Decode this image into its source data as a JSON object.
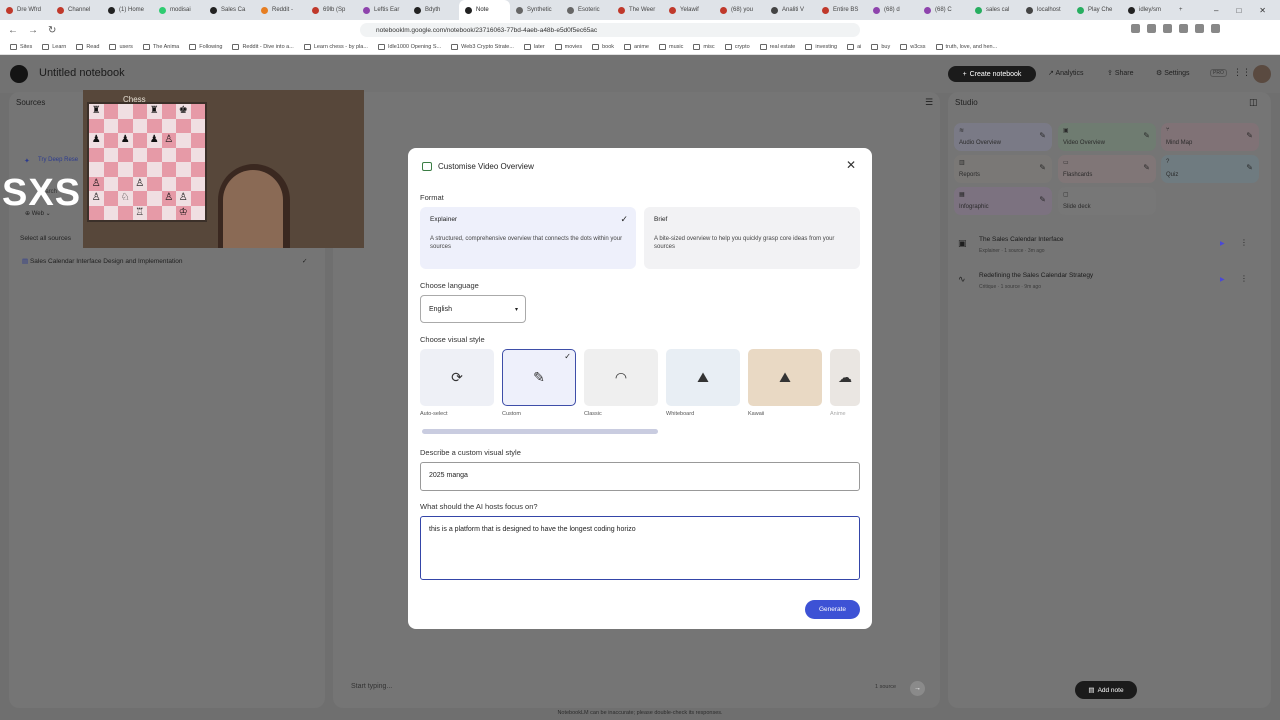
{
  "browser": {
    "tabs": [
      "Dre Wfrd",
      "Channel",
      "(1) Home",
      "modisai",
      "Sales Ca",
      "Reddit -",
      "69lb (Sp",
      "Leftis Ear",
      "Bdyth",
      "Note",
      "Synthetic",
      "Esoteric",
      "The Weer",
      "Yelawif",
      "(68) you",
      "Analiti V",
      "Entire BS",
      "(68) d",
      "(68) C",
      "sales cal",
      "localhost",
      "Play Che",
      "idley/sm"
    ],
    "url": "notebooklm.google.com/notebook/23716063-77bd-4aeb-a48b-e5d0f5ec65ac",
    "bookmarks": [
      "Sites",
      "Learn",
      "Read",
      "users",
      "The Anima",
      "Following",
      "Reddit - Dive into a...",
      "Learn chess - by pla...",
      "Idle1000 Opening S...",
      "Web3 Crypto Strate...",
      "later",
      "movies",
      "book",
      "anime",
      "music",
      "misc",
      "crypto",
      "real estate",
      "investing",
      "ai",
      "buy",
      "w3css",
      "truth, love, and hen..."
    ]
  },
  "app": {
    "notebook_title": "Untitled notebook",
    "create_label": "Create notebook",
    "analytics_label": "Analytics",
    "share_label": "Share",
    "settings_label": "Settings",
    "pro_label": "PRO"
  },
  "sources": {
    "title": "Sources",
    "deep_research": "Try Deep Rese",
    "search_partial": "Search",
    "web_label": "Web",
    "select_all": "Select all sources",
    "items": [
      "Sales Calendar Interface Design and Implementation"
    ]
  },
  "video": {
    "chess_label": "Chess",
    "board": [
      [
        "♜",
        "",
        "",
        "",
        "♜",
        "",
        "♚",
        ""
      ],
      [
        "",
        "",
        "",
        "",
        "",
        "",
        "",
        ""
      ],
      [
        "♟",
        "",
        "♟",
        "",
        "♟",
        "♙",
        "",
        ""
      ],
      [
        "",
        "",
        "",
        "",
        "",
        "",
        "",
        ""
      ],
      [
        "",
        "",
        "",
        "",
        "",
        "",
        "",
        ""
      ],
      [
        "♙",
        "",
        "",
        "♙",
        "",
        "",
        "",
        ""
      ],
      [
        "♙",
        "",
        "♘",
        "",
        "",
        "♙",
        "♙",
        ""
      ],
      [
        "",
        "",
        "",
        "♖",
        "",
        "",
        "♔",
        ""
      ]
    ]
  },
  "overlay_text": "SXS",
  "studio": {
    "title": "Studio",
    "tiles": [
      {
        "label": "Audio Overview",
        "color": "#7a7a86"
      },
      {
        "label": "Video Overview",
        "color": "#6f7c71"
      },
      {
        "label": "Mind Map",
        "color": "#807276"
      },
      {
        "label": "Reports",
        "color": "#7a7876"
      },
      {
        "label": "Flashcards",
        "color": "#807677"
      },
      {
        "label": "Quiz",
        "color": "#6f7b80"
      },
      {
        "label": "Infographic",
        "color": "#7c7280"
      },
      {
        "label": "Slide deck",
        "color": "#777777"
      }
    ],
    "notes": [
      {
        "title": "The Sales Calendar Interface",
        "meta": "Explainer · 1 source · 3m ago"
      },
      {
        "title": "Redefining the Sales Calendar Strategy",
        "meta": "Critique · 1 source · 9m ago"
      }
    ],
    "add_note": "Add note"
  },
  "modal": {
    "title": "Customise Video Overview",
    "format_label": "Format",
    "formats": [
      {
        "title": "Explainer",
        "desc": "A structured, comprehensive overview that connects the dots within your sources"
      },
      {
        "title": "Brief",
        "desc": "A bite-sized overview to help you quickly grasp core ideas from your sources"
      }
    ],
    "language_label": "Choose language",
    "language_value": "English",
    "style_label": "Choose visual style",
    "styles": [
      "Auto-select",
      "Custom",
      "Classic",
      "Whiteboard",
      "Kawaii",
      "Anime"
    ],
    "custom_label": "Describe a custom visual style",
    "custom_value": "2025 manga",
    "focus_label": "What should the AI hosts focus on?",
    "focus_value": "this is a platform that is designed to have the longest coding horizo",
    "generate_label": "Generate"
  },
  "chat": {
    "placeholder": "Start typing...",
    "source_count": "1 source"
  },
  "footer": "NotebookLM can be inaccurate; please double-check its responses."
}
